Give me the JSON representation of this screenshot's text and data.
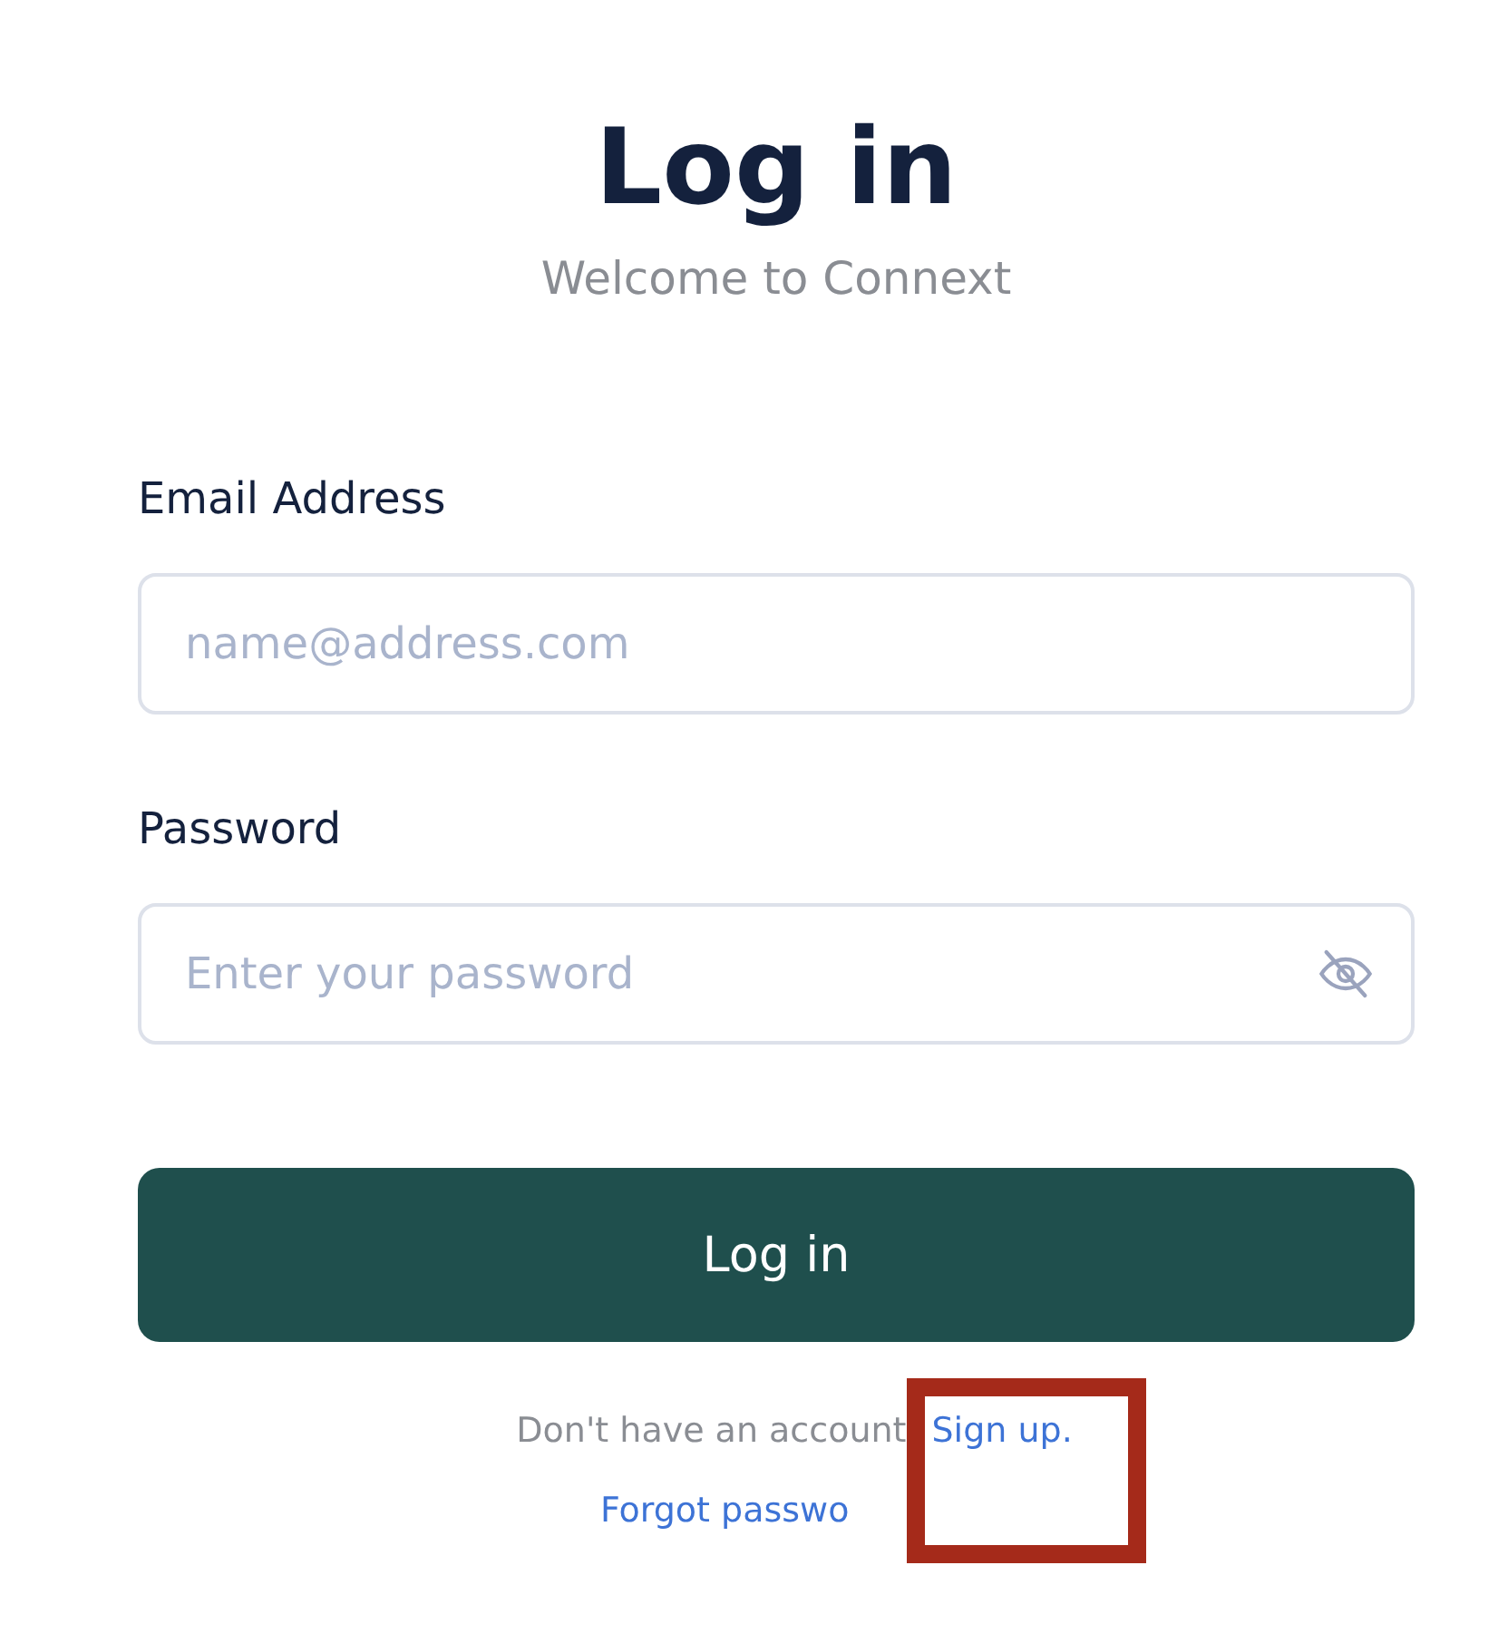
{
  "title": "Log in",
  "subtitle": "Welcome to Connext",
  "fields": [
    {
      "label": "Email Address",
      "placeholder": "name@address.com",
      "kind": "text"
    },
    {
      "label": "Password",
      "placeholder": "Enter your password",
      "kind": "password"
    }
  ],
  "submit_button": "Log in",
  "signup_prompt": {
    "text": "Don't have an account",
    "link": "Sign up."
  },
  "forgot_link": "Forgot passwo",
  "highlight": {
    "on": true
  }
}
